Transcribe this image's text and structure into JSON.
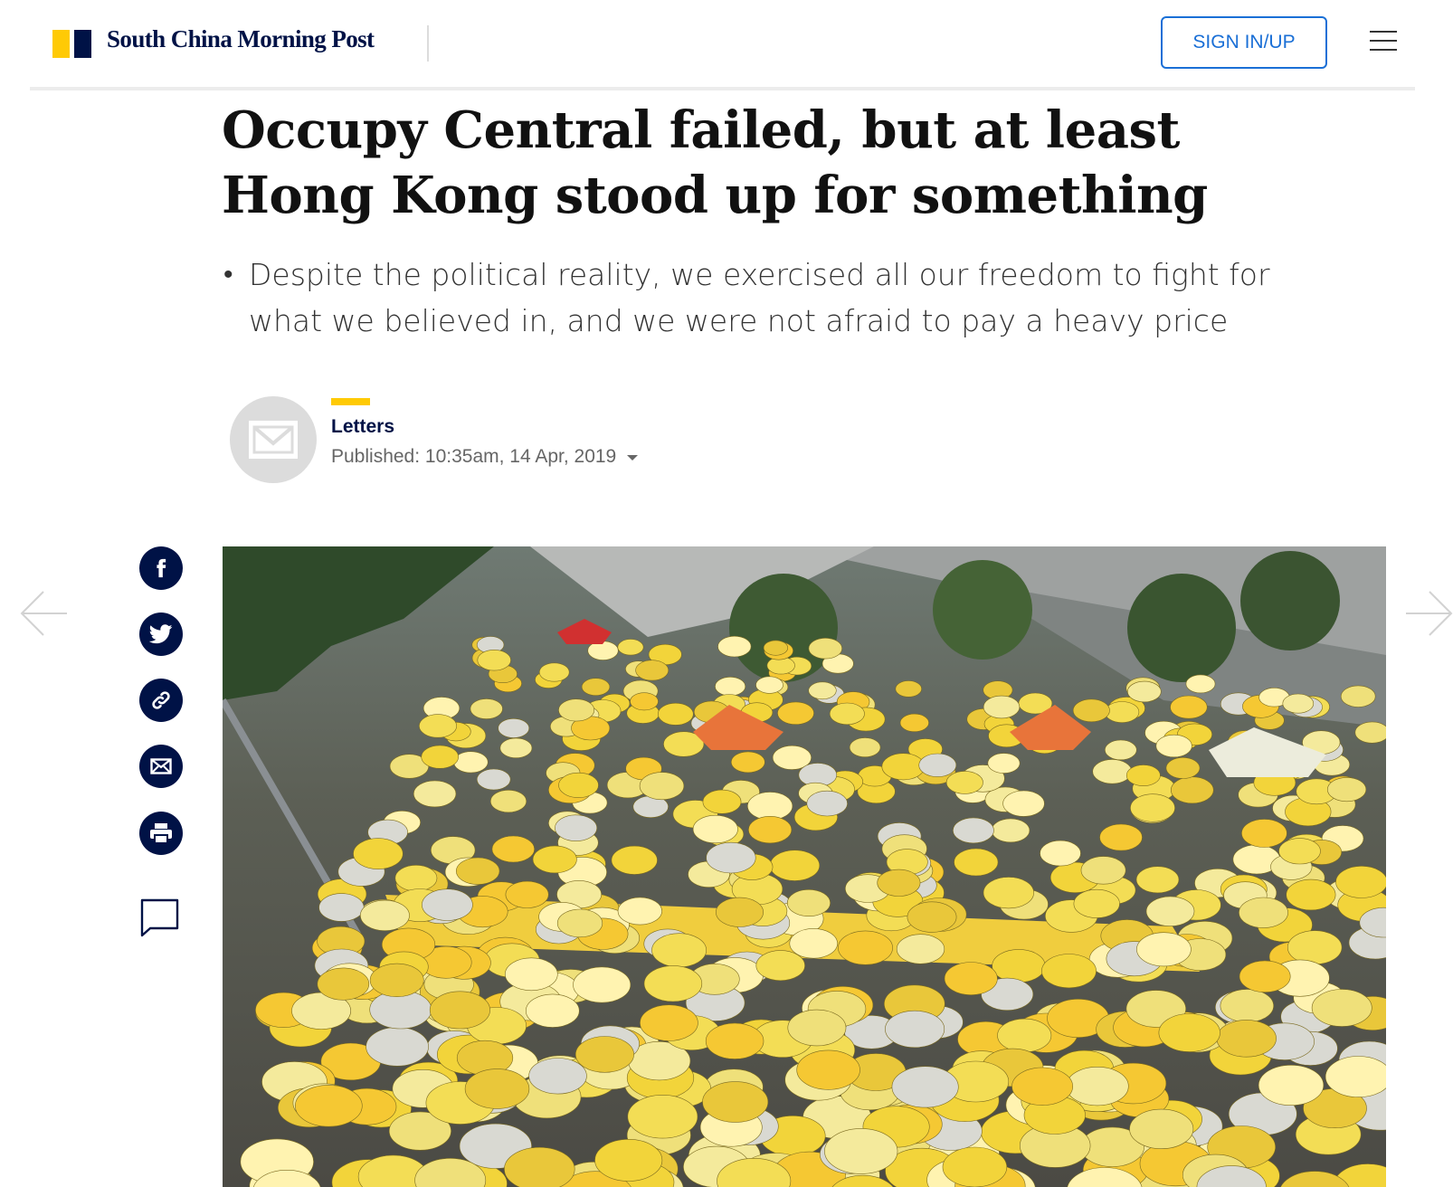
{
  "header": {
    "brand_name": "South China Morning Post",
    "signin_label": "SIGN IN/UP",
    "brand_colors": {
      "yellow": "#ffca05",
      "navy": "#001246",
      "link_blue": "#1a6fd6"
    }
  },
  "article": {
    "headline": "Occupy Central failed, but at least Hong Kong stood up for something",
    "summary": "Despite the political reality, we exercised all our freedom to fight for what we believed in, and we were not afraid to pay a heavy price",
    "author": "Letters",
    "published": "Published: 10:35am, 14 Apr, 2019"
  },
  "share": {
    "icons": [
      "facebook-icon",
      "twitter-icon",
      "link-icon",
      "email-icon",
      "print-icon",
      "comment-icon"
    ]
  },
  "navigation": {
    "icons": [
      "arrow-left-icon",
      "arrow-right-icon"
    ]
  },
  "image": {
    "description_icon": "photo"
  }
}
